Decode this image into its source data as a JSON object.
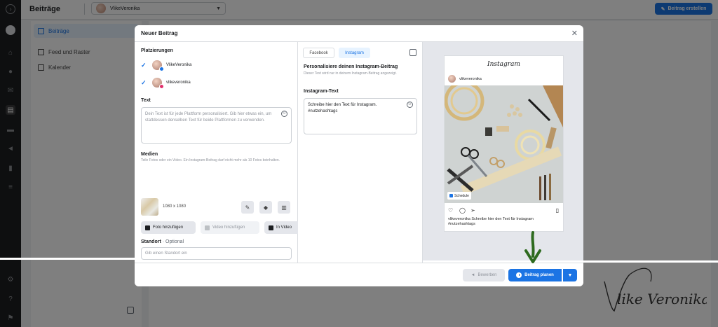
{
  "app": {
    "page_title": "Beiträge",
    "account_name": "VlikeVeronika",
    "create_button": "Beitrag erstellen",
    "sidebar": [
      {
        "label": "Beiträge",
        "active": true
      },
      {
        "label": "Feed und Raster",
        "active": false
      },
      {
        "label": "Kalender",
        "active": false
      }
    ]
  },
  "modal": {
    "title": "Neuer Beitrag",
    "placements_label": "Platzierungen",
    "placements": [
      {
        "name": "VlikeVeronika",
        "platform": "facebook",
        "checked": true
      },
      {
        "name": "vlikeveronika",
        "platform": "instagram",
        "checked": true
      }
    ],
    "text_label": "Text",
    "text_placeholder": "Dein Text ist für jede Plattform personalisiert. Gib hier etwas ein, um stattdessen denselben Text für beide Plattformen zu verwenden.",
    "media_label": "Medien",
    "media_help": "Teile Fotos oder ein Video. Ein Instagram-Beitrag darf nicht mehr als 10 Fotos beinhalten.",
    "media_dimensions": "1080 x 1080",
    "add_photo": "Foto hinzufügen",
    "add_video": "Video hinzufügen",
    "in_video": "In Video",
    "location_label": "Standort",
    "location_optional": "· Optional",
    "location_placeholder": "Gib einen Standort ein",
    "tabs": [
      "Facebook",
      "Instagram"
    ],
    "personalize_title": "Personalisiere deinen Instagram-Beitrag",
    "personalize_help": "Dieser Text wird nur in deinem Instagram-Beitrag angezeigt.",
    "ig_text_label": "Instagram-Text",
    "ig_text_value": "Schreibe hier den Text für Instagram. #nutzehashtags",
    "boost_button": "Bewerben",
    "schedule_button": "Beitrag planen"
  },
  "preview": {
    "logo": "Instagram",
    "username": "vlikeveronika",
    "schedule_badge": "Schedule",
    "caption_user": "vlikeveronika",
    "caption_text": "Schreibe hier den Text für Instagram #nutzehashtags"
  },
  "watermark": "Vlike Veronika",
  "colors": {
    "primary": "#1b74e4",
    "arrow": "#2e6b1f"
  }
}
